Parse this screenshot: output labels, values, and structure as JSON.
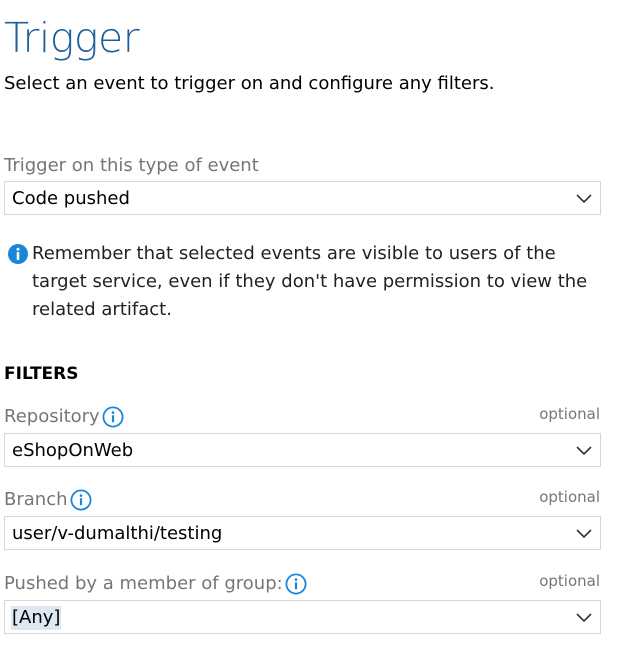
{
  "header": {
    "title": "Trigger",
    "subtitle": "Select an event to trigger on and configure any filters."
  },
  "event": {
    "label": "Trigger on this type of event",
    "selected": "Code pushed"
  },
  "note": {
    "text": "Remember that selected events are visible to users of the target service, even if they don't have permission to view the related artifact."
  },
  "filters": {
    "heading": "FILTERS",
    "repository": {
      "label": "Repository",
      "optional": "optional",
      "selected": "eShopOnWeb"
    },
    "branch": {
      "label": "Branch",
      "optional": "optional",
      "selected": "user/v-dumalthi/testing"
    },
    "group": {
      "label": "Pushed by a member of group:",
      "optional": "optional",
      "selected": "[Any]"
    }
  },
  "colors": {
    "title": "#1e5f99",
    "info_icon": "#1a86d8",
    "muted_text": "#767676",
    "border": "#d6d6d6",
    "selection_highlight": "#dde8f3"
  },
  "icons": {
    "info": "info-circle-icon",
    "dropdown": "chevron-down-icon"
  }
}
